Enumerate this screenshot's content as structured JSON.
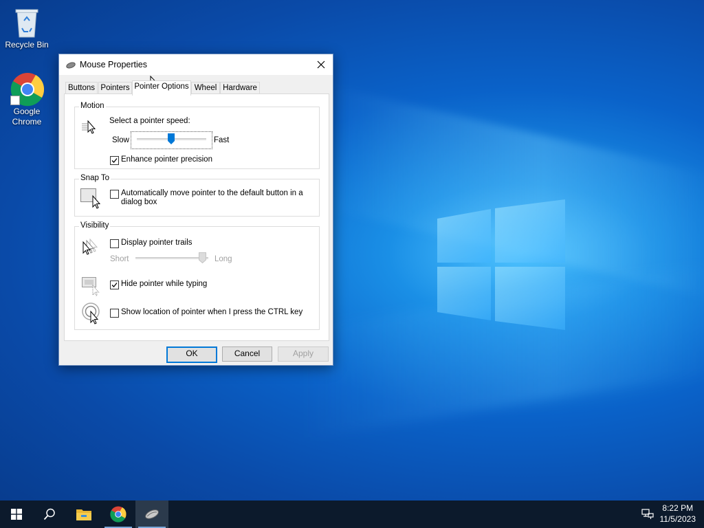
{
  "desktop": {
    "icons": [
      {
        "label": "Recycle Bin",
        "icon": "recycle-bin-icon"
      },
      {
        "label": "Google Chrome",
        "label_line1": "Google",
        "label_line2": "Chrome",
        "icon": "chrome-icon"
      }
    ]
  },
  "dialog": {
    "title": "Mouse Properties",
    "tabs": [
      "Buttons",
      "Pointers",
      "Pointer Options",
      "Wheel",
      "Hardware"
    ],
    "active_tab": "Pointer Options",
    "motion": {
      "legend": "Motion",
      "speed_label": "Select a pointer speed:",
      "slow": "Slow",
      "fast": "Fast",
      "speed_value_fraction": 0.5,
      "enhance_label": "Enhance pointer precision",
      "enhance_checked": true
    },
    "snap_to": {
      "legend": "Snap To",
      "auto_label_line1": "Automatically move pointer to the default button in a",
      "auto_label_line2": "dialog box",
      "auto_checked": false
    },
    "visibility": {
      "legend": "Visibility",
      "trails_label": "Display pointer trails",
      "trails_checked": false,
      "short": "Short",
      "long": "Long",
      "hide_label": "Hide pointer while typing",
      "hide_checked": true,
      "ctrl_label": "Show location of pointer when I press the CTRL key",
      "ctrl_checked": false
    },
    "buttons": {
      "ok": "OK",
      "cancel": "Cancel",
      "apply": "Apply"
    }
  },
  "taskbar": {
    "items": [
      "start-icon",
      "search-icon",
      "file-explorer-icon",
      "chrome-icon",
      "mouse-properties-icon"
    ],
    "time": "8:22 PM",
    "date": "11/5/2023"
  },
  "colors": {
    "accent": "#0078d7",
    "taskbar": "#0c1a2c"
  }
}
